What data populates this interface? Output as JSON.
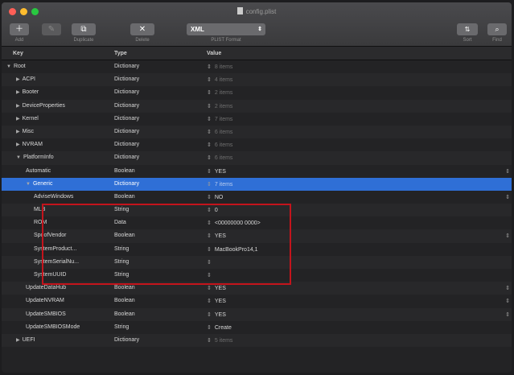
{
  "window": {
    "title": "config.plist"
  },
  "toolbar": {
    "add_label": "Add",
    "delete_label": "Delete",
    "duplicate_label": "Duplicate",
    "format_label": "PLIST Format",
    "format_value": "XML",
    "sort_label": "Sort",
    "find_label": "Find"
  },
  "table": {
    "headers": {
      "key": "Key",
      "type": "Type",
      "value": "Value"
    },
    "rows": [
      {
        "key": "Root",
        "type": "Dictionary",
        "value": "8 items",
        "indent": 0,
        "tri": "▼",
        "dim": true
      },
      {
        "key": "ACPI",
        "type": "Dictionary",
        "value": "4 items",
        "indent": 1,
        "tri": "▶",
        "dim": true
      },
      {
        "key": "Booter",
        "type": "Dictionary",
        "value": "2 items",
        "indent": 1,
        "tri": "▶",
        "dim": true
      },
      {
        "key": "DeviceProperties",
        "type": "Dictionary",
        "value": "2 items",
        "indent": 1,
        "tri": "▶",
        "dim": true
      },
      {
        "key": "Kernel",
        "type": "Dictionary",
        "value": "7 items",
        "indent": 1,
        "tri": "▶",
        "dim": true
      },
      {
        "key": "Misc",
        "type": "Dictionary",
        "value": "6 items",
        "indent": 1,
        "tri": "▶",
        "dim": true
      },
      {
        "key": "NVRAM",
        "type": "Dictionary",
        "value": "6 items",
        "indent": 1,
        "tri": "▶",
        "dim": true
      },
      {
        "key": "PlatformInfo",
        "type": "Dictionary",
        "value": "6 items",
        "indent": 1,
        "tri": "▼",
        "dim": true
      },
      {
        "key": "Automatic",
        "type": "Boolean",
        "value": "YES",
        "indent": 2,
        "tri": "",
        "dim": false,
        "rstep": true
      },
      {
        "key": "Generic",
        "type": "Dictionary",
        "value": "7 items",
        "indent": 2,
        "tri": "▼",
        "dim": true,
        "sel": true
      },
      {
        "key": "AdviseWindows",
        "type": "Boolean",
        "value": "NO",
        "indent": 3,
        "tri": "",
        "dim": false,
        "rstep": true
      },
      {
        "key": "MLB",
        "type": "String",
        "value": "0",
        "indent": 3,
        "tri": "",
        "dim": false
      },
      {
        "key": "ROM",
        "type": "Data",
        "value": "<00000000 0000>",
        "indent": 3,
        "tri": "",
        "dim": false
      },
      {
        "key": "SpoofVendor",
        "type": "Boolean",
        "value": "YES",
        "indent": 3,
        "tri": "",
        "dim": false,
        "rstep": true
      },
      {
        "key": "SystemProduct...",
        "type": "String",
        "value": "MacBookPro14,1",
        "indent": 3,
        "tri": "",
        "dim": false
      },
      {
        "key": "SystemSerialNu...",
        "type": "String",
        "value": "",
        "indent": 3,
        "tri": "",
        "dim": false
      },
      {
        "key": "SystemUUID",
        "type": "String",
        "value": "",
        "indent": 3,
        "tri": "",
        "dim": false
      },
      {
        "key": "UpdateDataHub",
        "type": "Boolean",
        "value": "YES",
        "indent": 2,
        "tri": "",
        "dim": false,
        "rstep": true
      },
      {
        "key": "UpdateNVRAM",
        "type": "Boolean",
        "value": "YES",
        "indent": 2,
        "tri": "",
        "dim": false,
        "rstep": true
      },
      {
        "key": "UpdateSMBIOS",
        "type": "Boolean",
        "value": "YES",
        "indent": 2,
        "tri": "",
        "dim": false,
        "rstep": true
      },
      {
        "key": "UpdateSMBIOSMode",
        "type": "String",
        "value": "Create",
        "indent": 2,
        "tri": "",
        "dim": false
      },
      {
        "key": "UEFI",
        "type": "Dictionary",
        "value": "5 items",
        "indent": 1,
        "tri": "▶",
        "dim": true
      }
    ]
  },
  "colors": {
    "selection": "#2f6fd6",
    "highlight_box": "#c4141c"
  }
}
